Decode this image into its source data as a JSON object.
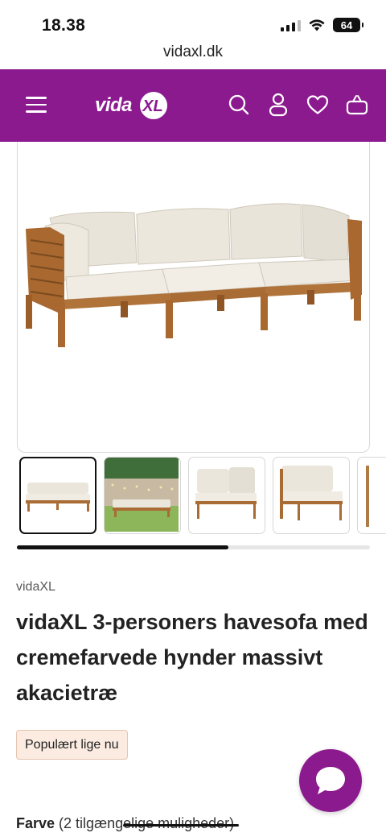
{
  "status_bar": {
    "time": "18.38",
    "battery": "64"
  },
  "browser": {
    "url": "vidaxl.dk"
  },
  "header": {
    "logo_text": "vida",
    "logo_mark": "XL",
    "icons": [
      "hamburger-menu-icon",
      "search-icon",
      "account-icon",
      "heart-icon",
      "basket-icon"
    ],
    "brand_color": "#8c1a8f"
  },
  "gallery": {
    "thumbnail_count": 5,
    "active_index": 0,
    "scroll_progress": 0.6
  },
  "product": {
    "brand": "vidaXL",
    "title": "vidaXL 3-personers havesofa med cremefarvede hynder massivt akacietræ",
    "badge": "Populært lige nu",
    "color_label": "Farve",
    "color_options_text": "(2 tilgængelige muligheder)"
  },
  "chat": {
    "icon": "chat-bubble-icon"
  }
}
